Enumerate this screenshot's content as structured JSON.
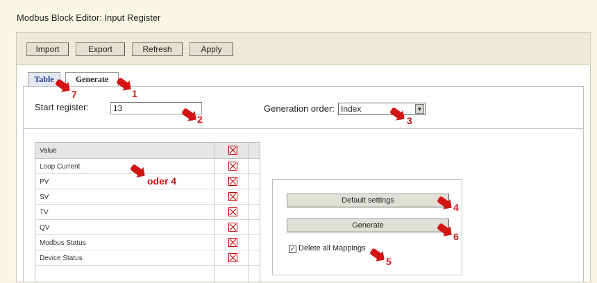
{
  "window_title": "Modbus Block Editor: Input Register",
  "toolbar": {
    "import_label": "Import",
    "export_label": "Export",
    "refresh_label": "Refresh",
    "apply_label": "Apply"
  },
  "tabs": [
    {
      "label": "Table"
    },
    {
      "label": "Generate"
    }
  ],
  "form": {
    "start_register_label": "Start register:",
    "start_register_value": "13",
    "generation_order_label": "Generation order:",
    "generation_order_value": "Index"
  },
  "grid": {
    "header": "Value",
    "rows": [
      {
        "label": "Loop Current"
      },
      {
        "label": "PV"
      },
      {
        "label": "SV"
      },
      {
        "label": "TV"
      },
      {
        "label": "QV"
      },
      {
        "label": "Modbus Status"
      },
      {
        "label": "Device Status"
      }
    ]
  },
  "actions": {
    "default_settings_label": "Default settings",
    "generate_label": "Generate",
    "delete_mappings_label": "Delete all Mappings",
    "delete_mappings_checked": true
  },
  "annotations": {
    "n1": "1",
    "n2": "2",
    "n3": "3",
    "n4": "4",
    "oder4": "oder 4",
    "n5": "5",
    "n6": "6",
    "n7": "7"
  },
  "colors": {
    "annotation": "#d21414",
    "background": "#f7f7e3",
    "tab_active": "#1b3a8a"
  }
}
